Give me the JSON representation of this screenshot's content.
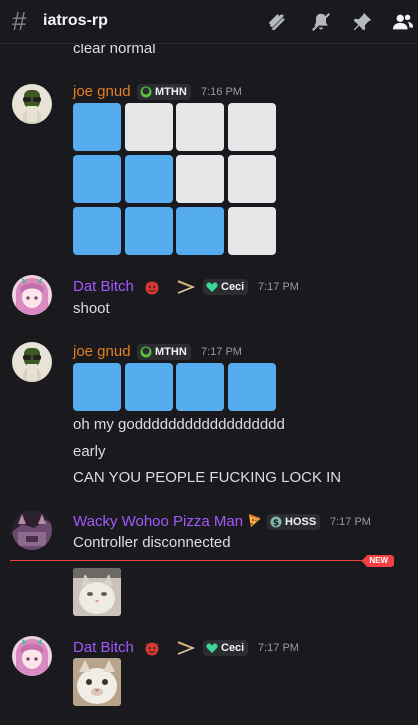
{
  "header": {
    "channel": "iatros-rp",
    "icons": [
      "threads-icon",
      "mute-bell-icon",
      "pin-icon",
      "members-icon"
    ]
  },
  "messages": {
    "top_cont": "clear normal",
    "m1": {
      "username": "joe gnud",
      "tag": "MTHN",
      "time": "7:16 PM",
      "grid": [
        [
          "blue",
          "white",
          "white",
          "white"
        ],
        [
          "blue",
          "blue",
          "white",
          "white"
        ],
        [
          "blue",
          "blue",
          "blue",
          "white"
        ]
      ]
    },
    "m2": {
      "username": "Dat Bitch",
      "emoji1": "devil-emoji",
      "emoji2": "arrow-emoji",
      "tag": "Ceci",
      "time": "7:17 PM",
      "text": "shoot"
    },
    "m3": {
      "username": "joe gnud",
      "tag": "MTHN",
      "time": "7:17 PM",
      "grid": [
        [
          "blue",
          "blue",
          "blue",
          "blue"
        ]
      ],
      "lines": [
        "oh my godddddddddddddddddd",
        "early",
        "CAN YOU PEOPLE FUCKING LOCK IN"
      ]
    },
    "m4": {
      "username": "Wacky Wohoo Pizza Man",
      "emoji": "pizza-emoji",
      "tag": "HOSS",
      "time": "7:17 PM",
      "text": "Controller disconnected"
    },
    "new_badge": "NEW",
    "m5": {
      "username": "Dat Bitch",
      "tag": "Ceci",
      "time": "7:17 PM"
    }
  },
  "colors": {
    "accent_blue": "#55acee",
    "new_red": "#f23f43",
    "joe_orange": "#e67e22",
    "purple": "#a358ff"
  }
}
